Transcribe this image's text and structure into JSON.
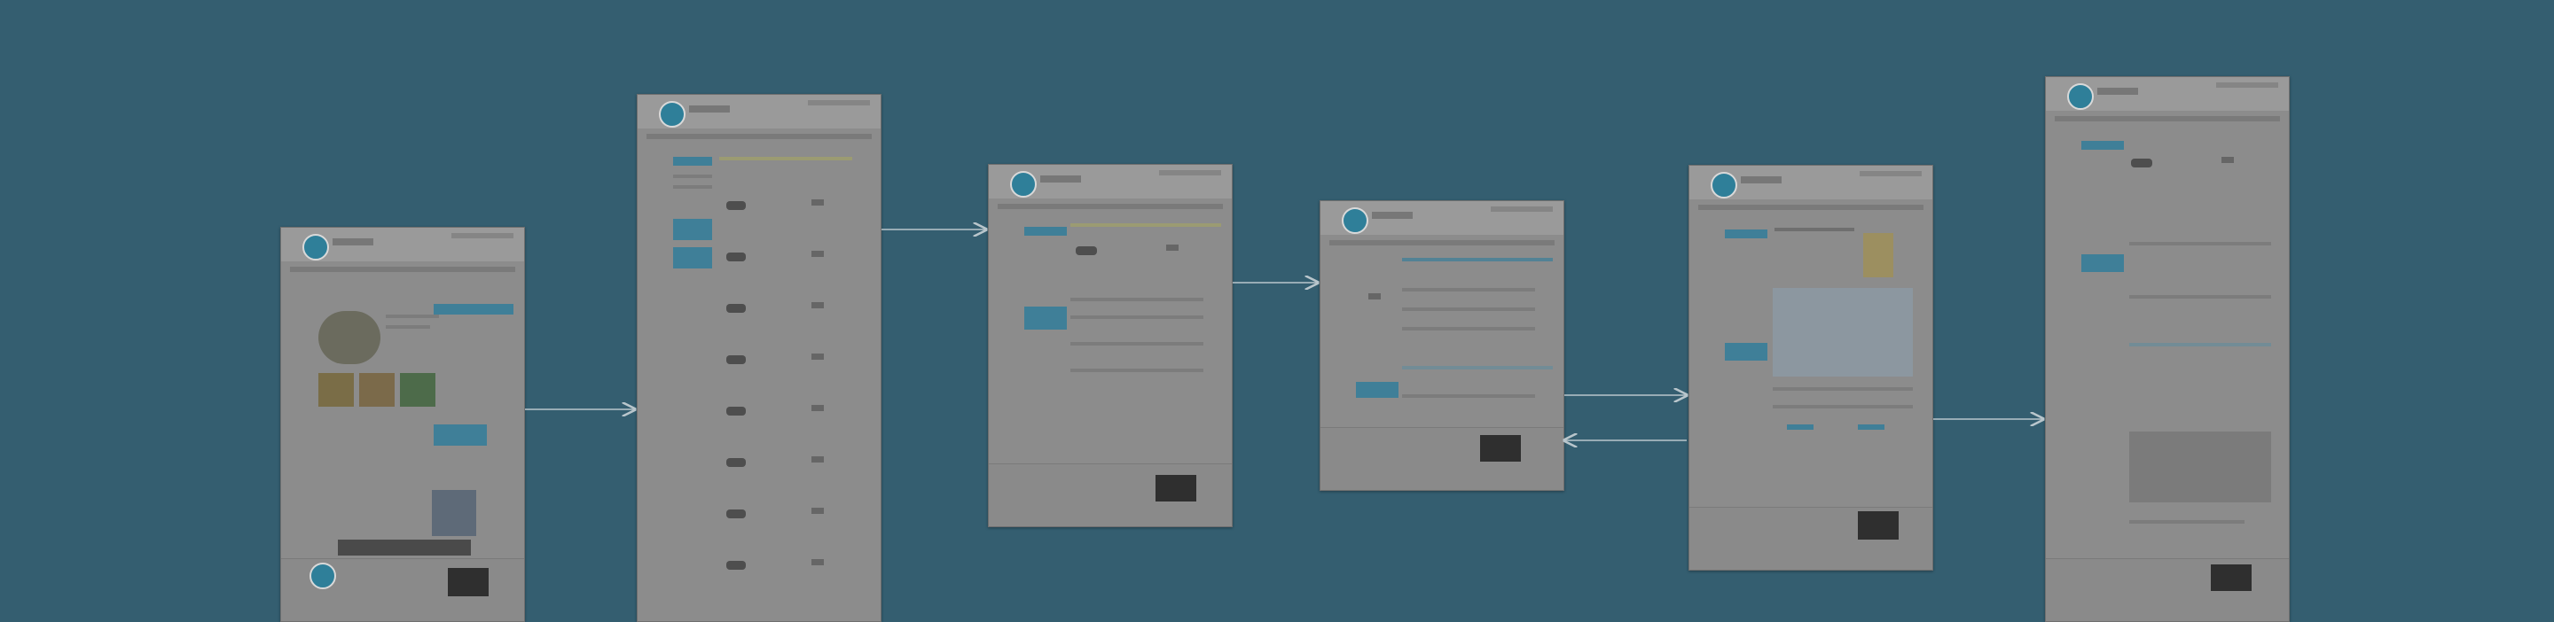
{
  "screens": [
    {
      "id": "home"
    },
    {
      "id": "car-results"
    },
    {
      "id": "car-details"
    },
    {
      "id": "driver-info"
    },
    {
      "id": "insurance"
    },
    {
      "id": "confirmation"
    }
  ],
  "flow": [
    {
      "from": "home",
      "to": "car-results"
    },
    {
      "from": "car-results",
      "to": "car-details"
    },
    {
      "from": "car-details",
      "to": "driver-info"
    },
    {
      "from": "driver-info",
      "to": "insurance"
    },
    {
      "from": "insurance",
      "to": "driver-info"
    },
    {
      "from": "insurance",
      "to": "confirmation"
    }
  ],
  "colors": {
    "background": "#345e70",
    "arrow": "#b9c6cc",
    "screenshot": "#8c8c8c",
    "accent": "#3f7f98"
  }
}
